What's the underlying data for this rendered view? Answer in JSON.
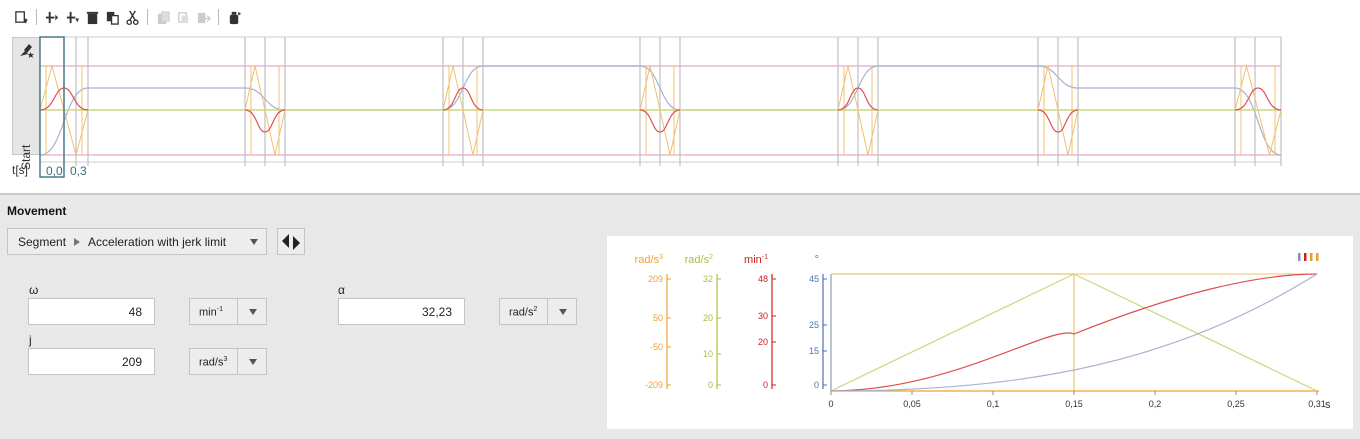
{
  "timeline": {
    "start_label": "Start",
    "time_unit_label": "t[s]",
    "time_values": [
      "0,0",
      "0,3"
    ],
    "colors": {
      "velocity": "#e05050",
      "accel": "#c8d880",
      "jerk": "#f0c070",
      "angle": "#a8b4d0",
      "limit": "#e8b8d0",
      "segment": "#c0c0c0",
      "active": "#4a7a8a"
    }
  },
  "toolbar": {
    "icons": [
      "new-segment-icon",
      "insert-before-icon",
      "insert-after-icon",
      "delete-icon",
      "copy-icon",
      "cut-icon",
      "paste-icon",
      "paste-disabled-icon",
      "paste-replace-icon",
      "export-icon"
    ]
  },
  "movement": {
    "heading": "Movement",
    "segment_label": "Segment",
    "segment_type": "Acceleration with jerk limit",
    "omega": {
      "label": "ω",
      "value": "48",
      "unit": "min",
      "unit_exp": "-1"
    },
    "alpha": {
      "label": "α",
      "value": "32,23",
      "unit": "rad/s",
      "unit_exp": "2"
    },
    "jerk": {
      "label": "j",
      "value": "209",
      "unit": "rad/s",
      "unit_exp": "3"
    }
  },
  "chart_data": {
    "type": "line",
    "x": [
      0,
      0.155,
      0.31
    ],
    "xlim": [
      0,
      0.31
    ],
    "xlabel": "s",
    "x_ticks": [
      "0",
      "0,05",
      "0,1",
      "0,15",
      "0,2",
      "0,25",
      "0,31"
    ],
    "axes": [
      {
        "unit": "rad/s",
        "unit_exp": "3",
        "color": "#f0a030",
        "ticks": [
          "209",
          "50",
          "-50",
          "-209"
        ]
      },
      {
        "unit": "rad/s",
        "unit_exp": "2",
        "color": "#a8c040",
        "ticks": [
          "32",
          "20",
          "10",
          "0"
        ]
      },
      {
        "unit": "min",
        "unit_exp": "-1",
        "color": "#cc2020",
        "ticks": [
          "48",
          "30",
          "20",
          "0"
        ]
      },
      {
        "unit": "°",
        "unit_exp": "",
        "color": "#5070b0",
        "ticks": [
          "45",
          "25",
          "15",
          "0"
        ]
      }
    ],
    "series": [
      {
        "key": "jerk",
        "values": [
          209,
          209,
          -209
        ],
        "color": "#f0c070"
      },
      {
        "key": "accel",
        "values": [
          0,
          32.23,
          0
        ],
        "color": "#c8d880"
      },
      {
        "key": "velocity",
        "values": [
          0,
          24,
          48
        ],
        "color": "#e05050"
      },
      {
        "key": "angle",
        "values": [
          0,
          11.25,
          45
        ],
        "color": "#a8b4d0"
      }
    ],
    "legend_colors": [
      "#8090c0",
      "#cc2020",
      "#e0a030",
      "#f0a030"
    ]
  }
}
